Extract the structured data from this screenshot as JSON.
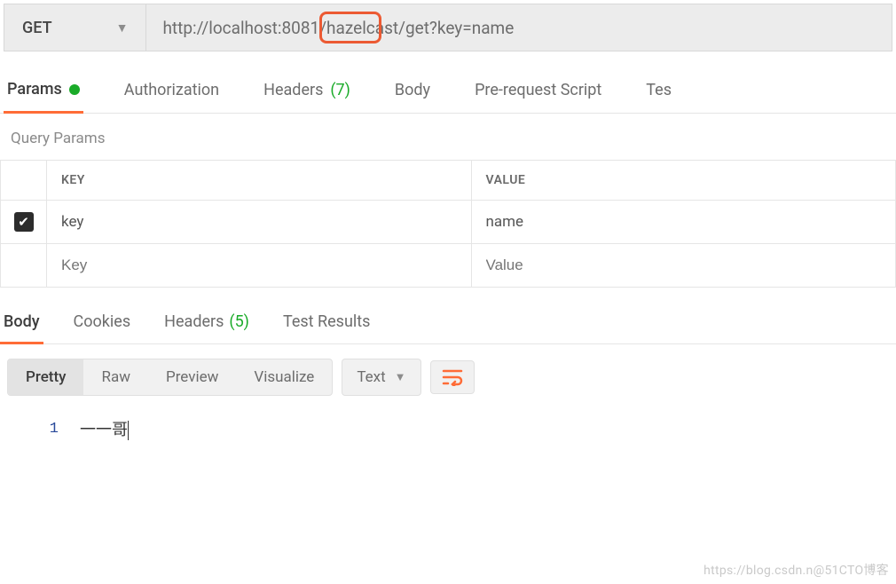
{
  "request": {
    "method": "GET",
    "url": "http://localhost:8081/hazelcast/get?key=name",
    "url_highlighted_segment": "8081"
  },
  "req_tabs": {
    "params": {
      "label": "Params",
      "active": true,
      "has_dot": true
    },
    "auth": {
      "label": "Authorization"
    },
    "headers": {
      "label": "Headers",
      "count": "(7)"
    },
    "body": {
      "label": "Body"
    },
    "prereq": {
      "label": "Pre-request Script"
    },
    "tests": {
      "label": "Tes"
    }
  },
  "params_section": {
    "title": "Query Params",
    "columns": {
      "key": "KEY",
      "value": "VALUE"
    },
    "rows": [
      {
        "checked": true,
        "key": "key",
        "value": "name"
      }
    ],
    "placeholder": {
      "key": "Key",
      "value": "Value"
    }
  },
  "resp_tabs": {
    "body": {
      "label": "Body",
      "active": true
    },
    "cookies": {
      "label": "Cookies"
    },
    "headers": {
      "label": "Headers",
      "count": "(5)"
    },
    "tests": {
      "label": "Test Results"
    }
  },
  "resp_toolbar": {
    "modes": {
      "pretty": "Pretty",
      "raw": "Raw",
      "preview": "Preview",
      "visualize": "Visualize"
    },
    "active_mode": "pretty",
    "format": "Text"
  },
  "response_body": {
    "line_no": "1",
    "text": "一一哥"
  },
  "watermark": "https://blog.csdn.n@51CTO博客"
}
